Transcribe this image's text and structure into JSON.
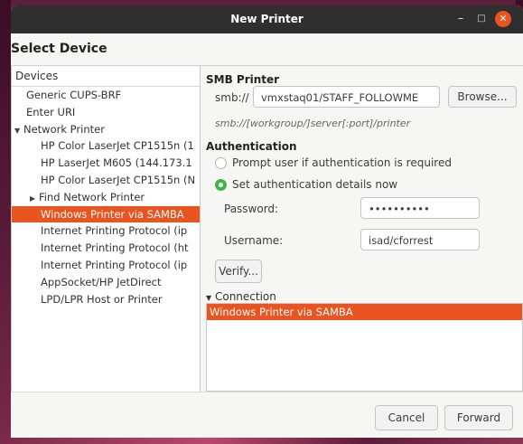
{
  "window": {
    "title": "New Printer"
  },
  "page": {
    "heading": "Select Device"
  },
  "devices": {
    "header": "Devices",
    "items": [
      {
        "label": "Generic CUPS-BRF",
        "level": 0,
        "expander": "",
        "selected": false
      },
      {
        "label": "Enter URI",
        "level": 0,
        "expander": "",
        "selected": false
      },
      {
        "label": "Network Printer",
        "level": 0,
        "expander": "▼",
        "selected": false
      },
      {
        "label": "HP Color LaserJet CP1515n (1",
        "level": 1,
        "expander": "",
        "selected": false
      },
      {
        "label": "HP LaserJet M605 (144.173.1",
        "level": 1,
        "expander": "",
        "selected": false
      },
      {
        "label": "HP Color LaserJet CP1515n (N",
        "level": 1,
        "expander": "",
        "selected": false
      },
      {
        "label": "Find Network Printer",
        "level": 1,
        "expander": "▶",
        "selected": false
      },
      {
        "label": "Windows Printer via SAMBA",
        "level": 1,
        "expander": "",
        "selected": true
      },
      {
        "label": "Internet Printing Protocol (ip",
        "level": 1,
        "expander": "",
        "selected": false
      },
      {
        "label": "Internet Printing Protocol (ht",
        "level": 1,
        "expander": "",
        "selected": false
      },
      {
        "label": "Internet Printing Protocol (ip",
        "level": 1,
        "expander": "",
        "selected": false
      },
      {
        "label": "AppSocket/HP JetDirect",
        "level": 1,
        "expander": "",
        "selected": false
      },
      {
        "label": "LPD/LPR Host or Printer",
        "level": 1,
        "expander": "",
        "selected": false
      }
    ]
  },
  "smb": {
    "section_label": "SMB Printer",
    "prefix": "smb://",
    "path_value": "vmxstaq01/STAFF_FOLLOWME",
    "browse_label": "Browse...",
    "hint": "smb://[workgroup/]server[:port]/printer"
  },
  "auth": {
    "section_label": "Authentication",
    "prompt_option": "Prompt user if authentication is required",
    "set_option": "Set authentication details now",
    "selected_option": "set",
    "password_label": "Password:",
    "password_value": "••••••••••",
    "username_label": "Username:",
    "username_value": "isad/cforrest",
    "verify_label": "Verify..."
  },
  "connection": {
    "header": "Connection",
    "expander": "▼",
    "items": [
      "Windows Printer via SAMBA"
    ]
  },
  "footer": {
    "cancel_label": "Cancel",
    "forward_label": "Forward"
  },
  "colors": {
    "accent": "#e95420",
    "radio_selected": "#3eb34f",
    "titlebar": "#2f2f2f"
  }
}
